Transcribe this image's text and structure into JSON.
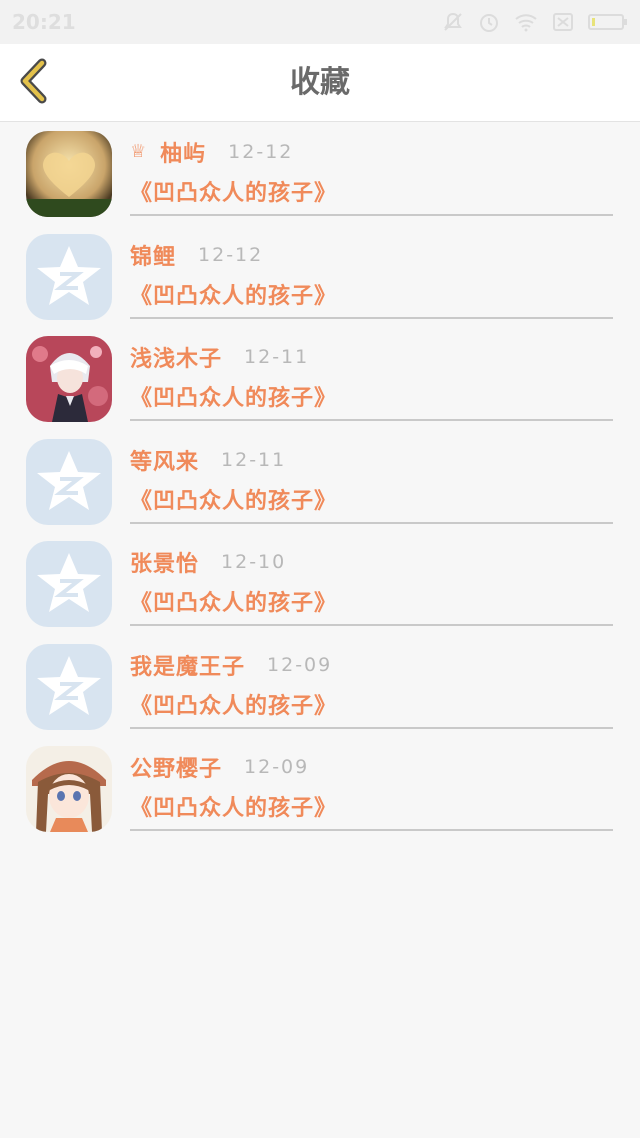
{
  "status_bar": {
    "time": "20:21",
    "icons": [
      "mute-icon",
      "alarm-icon",
      "wifi-icon",
      "sim-icon",
      "battery-icon"
    ]
  },
  "header": {
    "title": "收藏",
    "back_icon": "chevron-left-icon"
  },
  "colors": {
    "accent": "#f08a5a",
    "back_icon": "#e3c14a",
    "title": "#6a6a6a",
    "date": "#b8b8b8"
  },
  "favorites": [
    {
      "crown": "♕",
      "name": "柚屿",
      "date": "12-12",
      "book": "《凹凸众人的孩子》",
      "avatar": "heart-photo-avatar"
    },
    {
      "crown": "",
      "name": "锦鲤",
      "date": "12-12",
      "book": "《凹凸众人的孩子》",
      "avatar": "qzone-default-avatar"
    },
    {
      "crown": "",
      "name": "浅浅木子",
      "date": "12-11",
      "book": "《凹凸众人的孩子》",
      "avatar": "anime-boy-avatar"
    },
    {
      "crown": "",
      "name": "等风来",
      "date": "12-11",
      "book": "《凹凸众人的孩子》",
      "avatar": "qzone-default-avatar"
    },
    {
      "crown": "",
      "name": "张景怡",
      "date": "12-10",
      "book": "《凹凸众人的孩子》",
      "avatar": "qzone-default-avatar"
    },
    {
      "crown": "",
      "name": "我是魔王子",
      "date": "12-09",
      "book": "《凹凸众人的孩子》",
      "avatar": "qzone-default-avatar"
    },
    {
      "crown": "",
      "name": "公野樱子",
      "date": "12-09",
      "book": "《凹凸众人的孩子》",
      "avatar": "anime-girl-avatar"
    }
  ]
}
